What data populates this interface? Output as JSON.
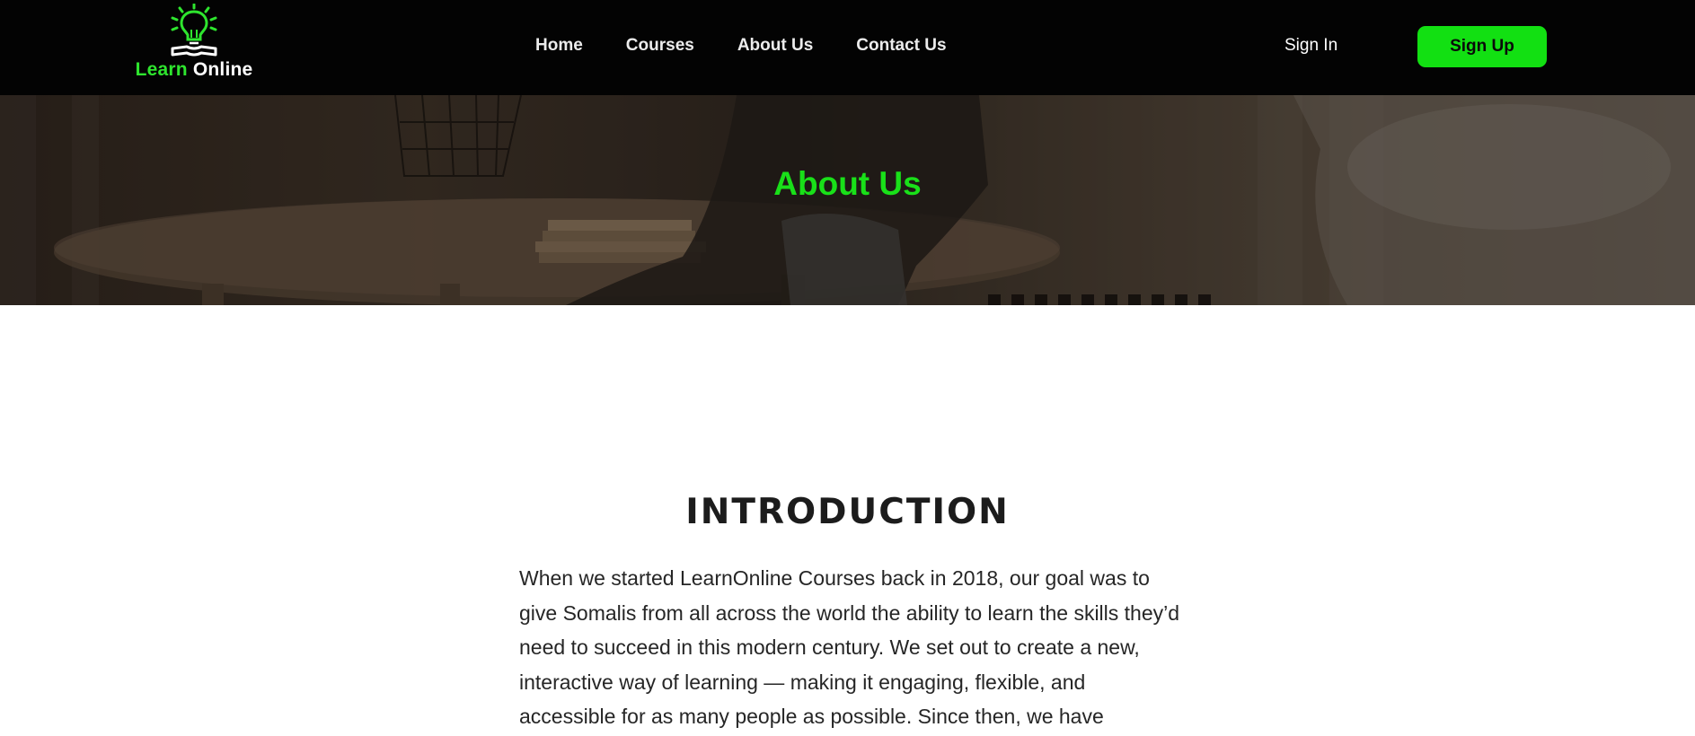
{
  "brand": {
    "name_part1": "Learn",
    "name_part2": "Online",
    "logo_icon": "lightbulb-book-icon",
    "accent_color": "#2ee52e"
  },
  "nav": {
    "items": [
      {
        "label": "Home"
      },
      {
        "label": "Courses"
      },
      {
        "label": "About Us"
      },
      {
        "label": "Contact Us"
      }
    ],
    "sign_in": "Sign In",
    "sign_up": "Sign Up",
    "sign_up_color": "#12e012"
  },
  "hero": {
    "title": "About Us"
  },
  "intro": {
    "heading": "INTRODUCTION",
    "body": "When we started LearnOnline Courses back in 2018, our goal was to give Somalis from all across the world the ability to learn the skills they’d need to succeed in this modern century. We set out to create a new, interactive way of learning — making it engaging, flexible, and accessible for as many people as possible. Since then, we have"
  }
}
